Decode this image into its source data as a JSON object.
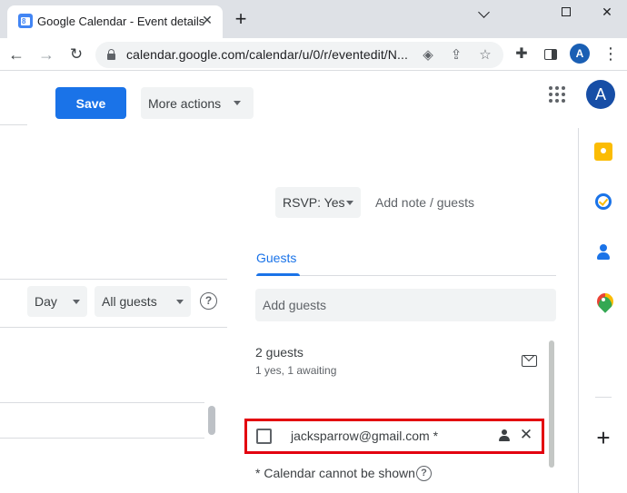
{
  "browser": {
    "tab_title": "Google Calendar - Event details",
    "tab_favicon_text": "8",
    "tab_close": "✕",
    "new_tab": "+",
    "window_close": "✕",
    "url": "calendar.google.com/calendar/u/0/r/eventedit/N...",
    "profile_initial": "A",
    "menu_dots": "⋮",
    "back": "←",
    "forward": "→",
    "reload": "↻",
    "eye_icon": "◈",
    "share_icon": "⇪",
    "star_icon": "☆",
    "puzzle_icon": "✚"
  },
  "header": {
    "save_label": "Save",
    "more_actions_label": "More actions",
    "account_initial": "A"
  },
  "event": {
    "rsvp_label": "RSVP: Yes",
    "add_note_label": "Add note / guests"
  },
  "calendar_pane": {
    "view_select": "Day",
    "guests_filter": "All guests",
    "help": "?"
  },
  "guests_panel": {
    "tab_label": "Guests",
    "add_guests_placeholder": "Add guests",
    "count_label": "2 guests",
    "status_summary": "1 yes, 1 awaiting",
    "guests": [
      {
        "email": "jacksparrow@gmail.com *"
      }
    ],
    "remove": "✕",
    "note": "* Calendar cannot be shown",
    "note_help": "?"
  },
  "side_panel": {
    "add_label": "+"
  },
  "colors": {
    "accent": "#1a73e8",
    "highlight_border": "#e3000f",
    "avatar": "#174ea6"
  }
}
